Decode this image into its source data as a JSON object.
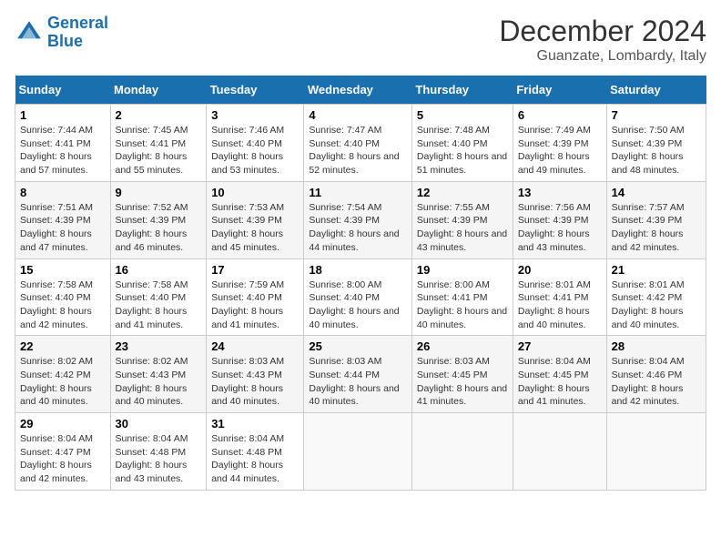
{
  "logo": {
    "line1": "General",
    "line2": "Blue"
  },
  "title": "December 2024",
  "subtitle": "Guanzate, Lombardy, Italy",
  "days_of_week": [
    "Sunday",
    "Monday",
    "Tuesday",
    "Wednesday",
    "Thursday",
    "Friday",
    "Saturday"
  ],
  "weeks": [
    [
      {
        "day": 1,
        "sunrise": "7:44 AM",
        "sunset": "4:41 PM",
        "daylight": "8 hours and 57 minutes."
      },
      {
        "day": 2,
        "sunrise": "7:45 AM",
        "sunset": "4:41 PM",
        "daylight": "8 hours and 55 minutes."
      },
      {
        "day": 3,
        "sunrise": "7:46 AM",
        "sunset": "4:40 PM",
        "daylight": "8 hours and 53 minutes."
      },
      {
        "day": 4,
        "sunrise": "7:47 AM",
        "sunset": "4:40 PM",
        "daylight": "8 hours and 52 minutes."
      },
      {
        "day": 5,
        "sunrise": "7:48 AM",
        "sunset": "4:40 PM",
        "daylight": "8 hours and 51 minutes."
      },
      {
        "day": 6,
        "sunrise": "7:49 AM",
        "sunset": "4:39 PM",
        "daylight": "8 hours and 49 minutes."
      },
      {
        "day": 7,
        "sunrise": "7:50 AM",
        "sunset": "4:39 PM",
        "daylight": "8 hours and 48 minutes."
      }
    ],
    [
      {
        "day": 8,
        "sunrise": "7:51 AM",
        "sunset": "4:39 PM",
        "daylight": "8 hours and 47 minutes."
      },
      {
        "day": 9,
        "sunrise": "7:52 AM",
        "sunset": "4:39 PM",
        "daylight": "8 hours and 46 minutes."
      },
      {
        "day": 10,
        "sunrise": "7:53 AM",
        "sunset": "4:39 PM",
        "daylight": "8 hours and 45 minutes."
      },
      {
        "day": 11,
        "sunrise": "7:54 AM",
        "sunset": "4:39 PM",
        "daylight": "8 hours and 44 minutes."
      },
      {
        "day": 12,
        "sunrise": "7:55 AM",
        "sunset": "4:39 PM",
        "daylight": "8 hours and 43 minutes."
      },
      {
        "day": 13,
        "sunrise": "7:56 AM",
        "sunset": "4:39 PM",
        "daylight": "8 hours and 43 minutes."
      },
      {
        "day": 14,
        "sunrise": "7:57 AM",
        "sunset": "4:39 PM",
        "daylight": "8 hours and 42 minutes."
      }
    ],
    [
      {
        "day": 15,
        "sunrise": "7:58 AM",
        "sunset": "4:40 PM",
        "daylight": "8 hours and 42 minutes."
      },
      {
        "day": 16,
        "sunrise": "7:58 AM",
        "sunset": "4:40 PM",
        "daylight": "8 hours and 41 minutes."
      },
      {
        "day": 17,
        "sunrise": "7:59 AM",
        "sunset": "4:40 PM",
        "daylight": "8 hours and 41 minutes."
      },
      {
        "day": 18,
        "sunrise": "8:00 AM",
        "sunset": "4:40 PM",
        "daylight": "8 hours and 40 minutes."
      },
      {
        "day": 19,
        "sunrise": "8:00 AM",
        "sunset": "4:41 PM",
        "daylight": "8 hours and 40 minutes."
      },
      {
        "day": 20,
        "sunrise": "8:01 AM",
        "sunset": "4:41 PM",
        "daylight": "8 hours and 40 minutes."
      },
      {
        "day": 21,
        "sunrise": "8:01 AM",
        "sunset": "4:42 PM",
        "daylight": "8 hours and 40 minutes."
      }
    ],
    [
      {
        "day": 22,
        "sunrise": "8:02 AM",
        "sunset": "4:42 PM",
        "daylight": "8 hours and 40 minutes."
      },
      {
        "day": 23,
        "sunrise": "8:02 AM",
        "sunset": "4:43 PM",
        "daylight": "8 hours and 40 minutes."
      },
      {
        "day": 24,
        "sunrise": "8:03 AM",
        "sunset": "4:43 PM",
        "daylight": "8 hours and 40 minutes."
      },
      {
        "day": 25,
        "sunrise": "8:03 AM",
        "sunset": "4:44 PM",
        "daylight": "8 hours and 40 minutes."
      },
      {
        "day": 26,
        "sunrise": "8:03 AM",
        "sunset": "4:45 PM",
        "daylight": "8 hours and 41 minutes."
      },
      {
        "day": 27,
        "sunrise": "8:04 AM",
        "sunset": "4:45 PM",
        "daylight": "8 hours and 41 minutes."
      },
      {
        "day": 28,
        "sunrise": "8:04 AM",
        "sunset": "4:46 PM",
        "daylight": "8 hours and 42 minutes."
      }
    ],
    [
      {
        "day": 29,
        "sunrise": "8:04 AM",
        "sunset": "4:47 PM",
        "daylight": "8 hours and 42 minutes."
      },
      {
        "day": 30,
        "sunrise": "8:04 AM",
        "sunset": "4:48 PM",
        "daylight": "8 hours and 43 minutes."
      },
      {
        "day": 31,
        "sunrise": "8:04 AM",
        "sunset": "4:48 PM",
        "daylight": "8 hours and 44 minutes."
      },
      null,
      null,
      null,
      null
    ]
  ]
}
